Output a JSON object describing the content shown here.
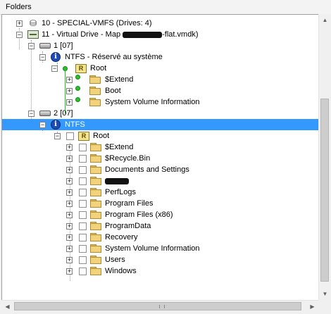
{
  "panel": {
    "title": "Folders"
  },
  "tree": {
    "vmfs_node": "10 - SPECIAL-VMFS (Drives: 4)",
    "virtual_drive_prefix": "11 - Virtual Drive - Map ",
    "virtual_drive_suffix": "-flat.vmdk)",
    "partition1": "1 [07]",
    "ntfs_reserved": "NTFS - Réservé au système",
    "root1": "Root",
    "root1_children": [
      "$Extend",
      "Boot",
      "System Volume Information"
    ],
    "partition2": "2 [07]",
    "ntfs_selected": "NTFS",
    "root2": "Root",
    "root2_children": [
      "$Extend",
      "$Recycle.Bin",
      "Documents and Settings",
      "",
      "PerfLogs",
      "Program Files",
      "Program Files (x86)",
      "ProgramData",
      "Recovery",
      "System Volume Information",
      "Users",
      "Windows"
    ]
  },
  "icons": {
    "root_badge": "R",
    "info_badge": "i",
    "vmfs": "⛁"
  },
  "colors": {
    "selection": "#3399ff",
    "folder": "#f2d27a",
    "status_dot": "#2bc02b"
  }
}
